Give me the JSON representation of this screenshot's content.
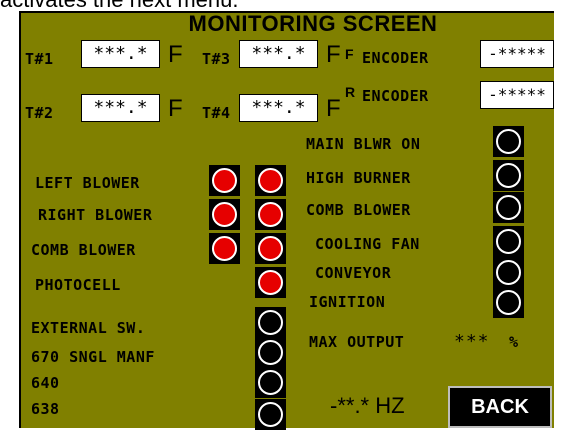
{
  "caption": "activates the next menu.",
  "screen": {
    "title": "MONITORING SCREEN",
    "temps": [
      {
        "label": "T#1",
        "value": "***.*",
        "unit": "F"
      },
      {
        "label": "T#2",
        "value": "***.*",
        "unit": "F"
      },
      {
        "label": "T#3",
        "value": "***.*",
        "unit": "F"
      },
      {
        "label": "T#4",
        "value": "***.*",
        "unit": "F"
      }
    ],
    "encoders": [
      {
        "prefix": "F",
        "label": "ENCODER",
        "value": "-*****"
      },
      {
        "prefix": "R",
        "label": "ENCODER",
        "value": "-*****"
      }
    ],
    "left_rows": [
      {
        "label": "LEFT BLOWER",
        "lamps": [
          "red",
          "red"
        ]
      },
      {
        "label": "RIGHT BLOWER",
        "lamps": [
          "red",
          "red"
        ]
      },
      {
        "label": "COMB BLOWER",
        "lamps": [
          "red",
          "red"
        ]
      },
      {
        "label": "PHOTOCELL",
        "lamps": [
          "red"
        ]
      },
      {
        "label": "EXTERNAL SW.",
        "lamps": [
          "black"
        ]
      },
      {
        "label": "670 SNGL MANF",
        "lamps": [
          "black"
        ]
      },
      {
        "label": "640",
        "lamps": [
          "black"
        ]
      },
      {
        "label": "638",
        "lamps": [
          "black"
        ]
      }
    ],
    "right_rows": [
      {
        "label": "MAIN BLWR ON",
        "lamp": "black"
      },
      {
        "label": "HIGH BURNER",
        "lamp": "black"
      },
      {
        "label": "COMB BLOWER",
        "lamp": "black"
      },
      {
        "label": "COOLING FAN",
        "lamp": "black"
      },
      {
        "label": "CONVEYOR",
        "lamp": "black"
      },
      {
        "label": "IGNITION",
        "lamp": "black"
      }
    ],
    "max_output": {
      "label": "MAX OUTPUT",
      "value": "***",
      "unit": "%"
    },
    "frequency": {
      "value": "-**.*",
      "unit": "HZ"
    },
    "back_label": "BACK"
  },
  "colors": {
    "panel": "#808000",
    "lamp_on": "#e60000",
    "lamp_off": "#000000"
  }
}
